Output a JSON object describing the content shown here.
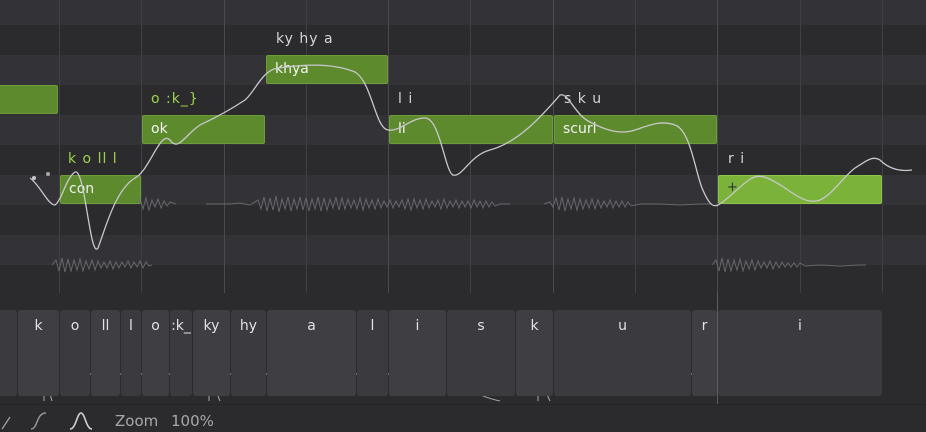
{
  "notes": [
    {
      "label": "",
      "phonemes": "",
      "selected": false
    },
    {
      "label": "con",
      "phonemes": "k o ll l",
      "selected": false
    },
    {
      "label": "ok",
      "phonemes": "o :k_}",
      "selected": false
    },
    {
      "label": "khya",
      "phonemes": "ky hy a",
      "selected": false
    },
    {
      "label": "li",
      "phonemes": "l i",
      "selected": false
    },
    {
      "label": "scuri",
      "phonemes": "s k u",
      "selected": false
    },
    {
      "label": "",
      "phonemes": "r i",
      "selected": true
    }
  ],
  "phoneme_cells": [
    "k",
    "o",
    "ll",
    "l",
    "o",
    ":k_",
    "ky",
    "hy",
    "a",
    "l",
    "i",
    "s",
    "k",
    "u",
    "r",
    "i"
  ],
  "footer": {
    "zoom_label": "Zoom",
    "zoom_value": "100%",
    "curve_icon_1": "ease-curve-icon",
    "curve_icon_2": "bell-curve-icon"
  },
  "colors": {
    "note": "#5e8a2e",
    "note_selected": "#7bb33a",
    "phoneme_green": "#9bd24c",
    "background": "#313135"
  }
}
